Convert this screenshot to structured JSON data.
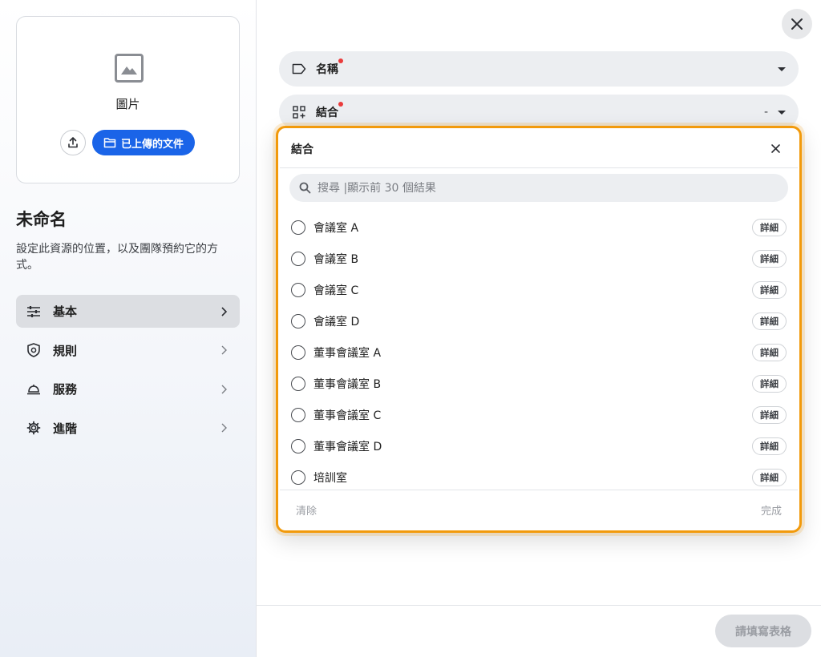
{
  "image_card": {
    "label": "圖片",
    "upload_icon": "upload-icon",
    "uploaded_files_label": "已上傳的文件",
    "uploaded_files_icon": "folder-icon"
  },
  "resource": {
    "title": "未命名",
    "description": "設定此資源的位置，以及團隊預約它的方式。"
  },
  "nav": {
    "items": [
      {
        "label": "基本",
        "icon": "sliders-icon",
        "active": true
      },
      {
        "label": "規則",
        "icon": "shield-icon",
        "active": false
      },
      {
        "label": "服務",
        "icon": "service-bell-icon",
        "active": false
      },
      {
        "label": "進階",
        "icon": "gear-icon",
        "active": false
      }
    ]
  },
  "form": {
    "name_field": {
      "label": "名稱",
      "icon": "tag-icon",
      "required": true
    },
    "combine_field": {
      "label": "結合",
      "icon": "grid-add-icon",
      "required": true,
      "value": "-"
    },
    "submit_label": "請填寫表格"
  },
  "combine_popup": {
    "title": "結合",
    "search_placeholder": "搜尋 |顯示前 30 個結果",
    "detail_label": "詳細",
    "items": [
      {
        "label": "會議室 A"
      },
      {
        "label": "會議室 B"
      },
      {
        "label": "會議室 C"
      },
      {
        "label": "會議室 D"
      },
      {
        "label": "董事會議室 A"
      },
      {
        "label": "董事會議室 B"
      },
      {
        "label": "董事會議室 C"
      },
      {
        "label": "董事會議室 D"
      },
      {
        "label": "培訓室"
      }
    ],
    "clear_label": "清除",
    "done_label": "完成"
  },
  "colors": {
    "primary": "#1a64e8",
    "highlight_outline": "#f29a0b",
    "required_dot": "#ea3b3b"
  }
}
